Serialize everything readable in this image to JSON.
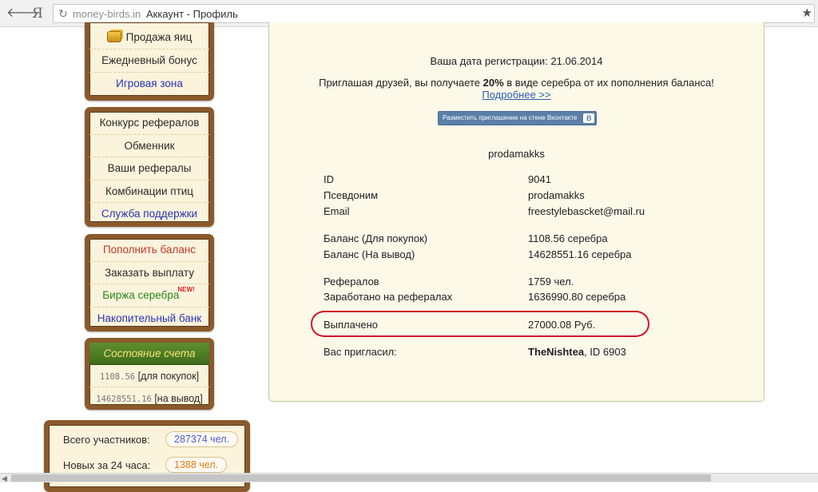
{
  "browser": {
    "back_glyph": "🡐",
    "yandex_glyph": "Я",
    "reload_glyph": "↻",
    "domain": "money-birds.in",
    "page_title": "Аккаунт - Профиль",
    "star_glyph": "★"
  },
  "sidebar": {
    "panel1": [
      "Продажа яиц",
      "Ежедневный бонус",
      "Игровая зона"
    ],
    "panel2": [
      "Конкурс рефералов",
      "Обменник",
      "Ваши рефералы",
      "Комбинации птиц",
      "Служба поддержки"
    ],
    "panel3": [
      "Пополнить баланс",
      "Заказать выплату",
      "Биржа серебра",
      "Накопительный банк"
    ],
    "new_badge": "NEW!",
    "account": {
      "header": "Состояние счета",
      "purchase_value": "1108.56",
      "purchase_label": "[для покупок]",
      "withdraw_value": "14628551.16",
      "withdraw_label": "[на вывод]"
    },
    "stats": {
      "total_label": "Всего участников:",
      "total_value": "287374 чел.",
      "new_label": "Новых за 24 часа:",
      "new_value": "1388 чел."
    }
  },
  "main": {
    "reg_date": "Ваша дата регистрации: 21.06.2014",
    "invite_prefix": "Приглашая друзей, вы получаете ",
    "invite_percent": "20%",
    "invite_suffix": " в виде серебра от их пополнения баланса!",
    "more_link": "Подробнее >>",
    "vk_button": "Разместить приглашение на стене Вконтакте",
    "vk_logo": "B",
    "username": "prodamakks",
    "rows": [
      {
        "label": "ID",
        "value": "9041"
      },
      {
        "label": "Псевдоним",
        "value": "prodamakks"
      },
      {
        "label": "Email",
        "value": "freestylebascket@mail.ru"
      },
      {
        "label": "Баланс (Для покупок)",
        "value": "1108.56 серебра"
      },
      {
        "label": "Баланс (На вывод)",
        "value": "14628551.16 серебра"
      },
      {
        "label": "Рефералов",
        "value": "1759 чел."
      },
      {
        "label": "Заработано на рефералах",
        "value": "1636990.80 серебра"
      },
      {
        "label": "Выплачено",
        "value": "27000.08 Руб."
      }
    ],
    "inviter_label": "Вас пригласил:",
    "inviter_name": "TheNishtea",
    "inviter_id": ", ID 6903"
  },
  "colors": {
    "wood_border": "#8a5a2b",
    "panel_bg": "#fcf9e9",
    "highlight": "#d2152a",
    "link": "#2a5db0"
  }
}
